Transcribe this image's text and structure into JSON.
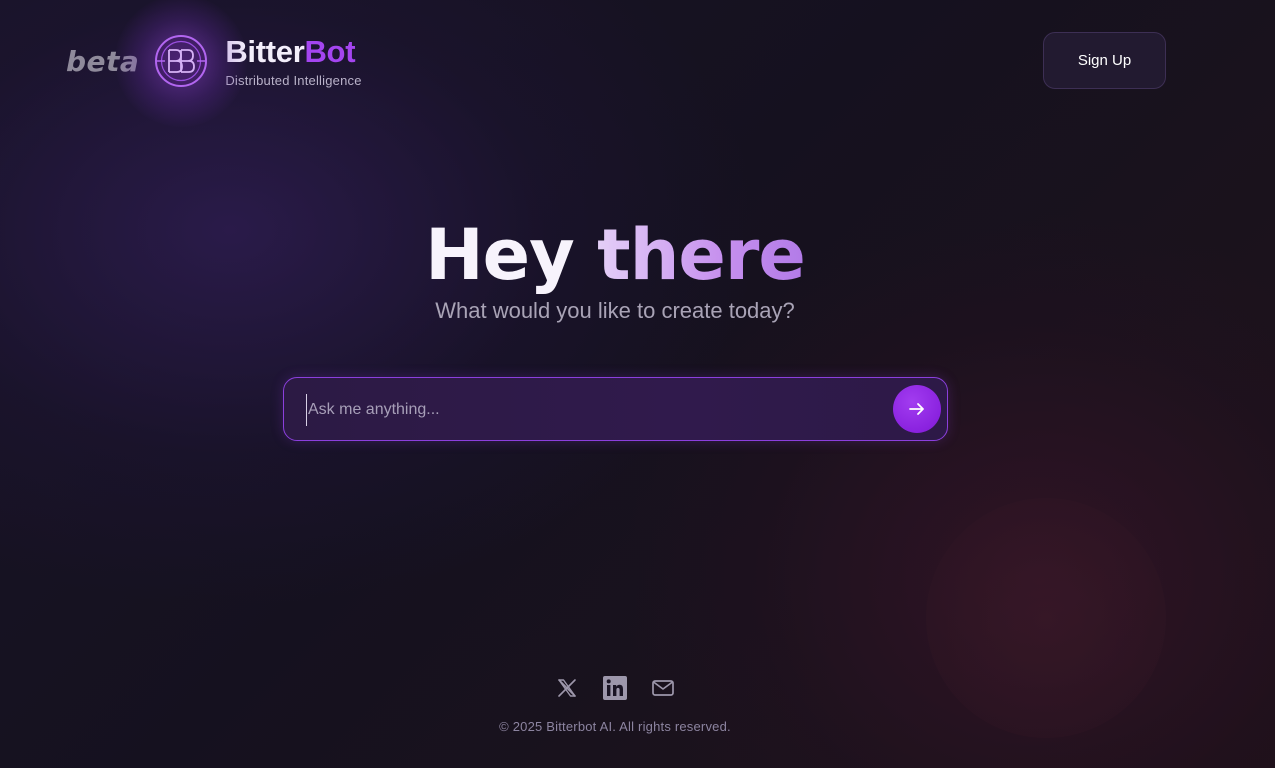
{
  "header": {
    "beta_label": "beta",
    "brand_name_part1": "Bitter",
    "brand_name_part2": "Bot",
    "brand_tagline": "Distributed Intelligence",
    "signup_label": "Sign Up",
    "logo_icon": "bb-monogram-icon"
  },
  "hero": {
    "title_part1": "Hey",
    "title_part2": "there",
    "subtitle": "What would you like to create today?"
  },
  "search": {
    "placeholder": "Ask me anything...",
    "value": "",
    "submit_icon": "arrow-right-icon"
  },
  "footer": {
    "socials": [
      "x-icon",
      "linkedin-icon",
      "mail-icon"
    ],
    "copyright": "© 2025 Bitterbot AI. All rights reserved."
  },
  "colors": {
    "accent": "#a445f0",
    "send_button": "#8a22df",
    "background": "#17121f"
  }
}
